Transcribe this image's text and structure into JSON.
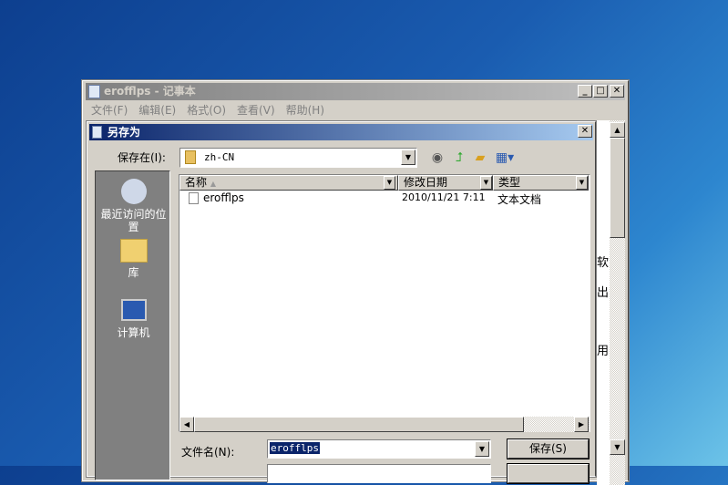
{
  "notepad": {
    "title": "erofflps - 记事本",
    "menu": [
      "文件(F)",
      "编辑(E)",
      "格式(O)",
      "查看(V)",
      "帮助(H)"
    ],
    "text_fragments": [
      "软",
      "出",
      "用"
    ]
  },
  "dialog": {
    "title": "另存为",
    "save_in_label": "保存在(I):",
    "save_in_value": "zh-CN",
    "places": [
      "最近访问的位置",
      "库",
      "计算机"
    ],
    "columns": [
      "名称",
      "修改日期",
      "类型"
    ],
    "files": [
      {
        "name": "erofflps",
        "modified": "2010/11/21 7:11",
        "type": "文本文档"
      }
    ],
    "filename_label": "文件名(N):",
    "filename_value": "erofflps",
    "save_button": "保存(S)"
  }
}
